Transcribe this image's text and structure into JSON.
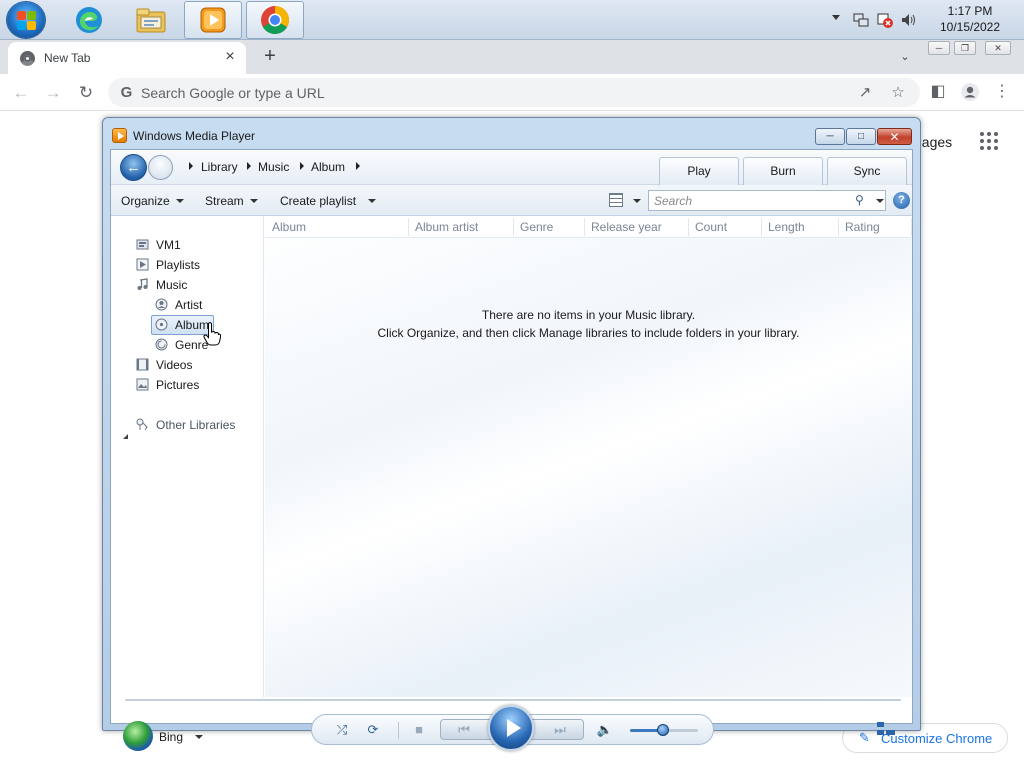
{
  "taskbar": {
    "time": "1:17 PM",
    "date": "10/15/2022",
    "icons": [
      "windows-start-icon",
      "edge-icon",
      "file-explorer-icon",
      "windows-media-player-icon",
      "chrome-icon"
    ]
  },
  "chrome": {
    "tab_title": "New Tab",
    "tab_close": "×",
    "new_tab": "+",
    "omnibox_placeholder": "Search Google or type a URL",
    "ntp_images_link": "nages",
    "customize_label": "Customize Chrome",
    "accent": "#1a73e8"
  },
  "wmp": {
    "title": "Windows Media Player",
    "breadcrumbs": [
      "Library",
      "Music",
      "Album"
    ],
    "tabs": [
      "Play",
      "Burn",
      "Sync"
    ],
    "commands": [
      "Organize",
      "Stream",
      "Create playlist"
    ],
    "search_placeholder": "Search",
    "help_glyph": "?",
    "nav_items": [
      {
        "label": "VM1",
        "icon": "library-icon"
      },
      {
        "label": "Playlists",
        "icon": "playlists-icon"
      },
      {
        "label": "Music",
        "icon": "music-icon"
      },
      {
        "label": "Artist",
        "icon": "artist-icon"
      },
      {
        "label": "Album",
        "icon": "album-icon"
      },
      {
        "label": "Genre",
        "icon": "genre-icon"
      },
      {
        "label": "Videos",
        "icon": "videos-icon"
      },
      {
        "label": "Pictures",
        "icon": "pictures-icon"
      },
      {
        "label": "Other Libraries",
        "icon": "other-libraries-icon"
      }
    ],
    "selected_nav": "Album",
    "bing_label": "Bing",
    "columns": [
      "Album",
      "Album artist",
      "Genre",
      "Release year",
      "Count",
      "Length",
      "Rating"
    ],
    "empty_line1": "There are no items in your Music library.",
    "empty_line2": "Click Organize, and then click Manage libraries to include folders in your library.",
    "volume_fraction": 0.45
  }
}
